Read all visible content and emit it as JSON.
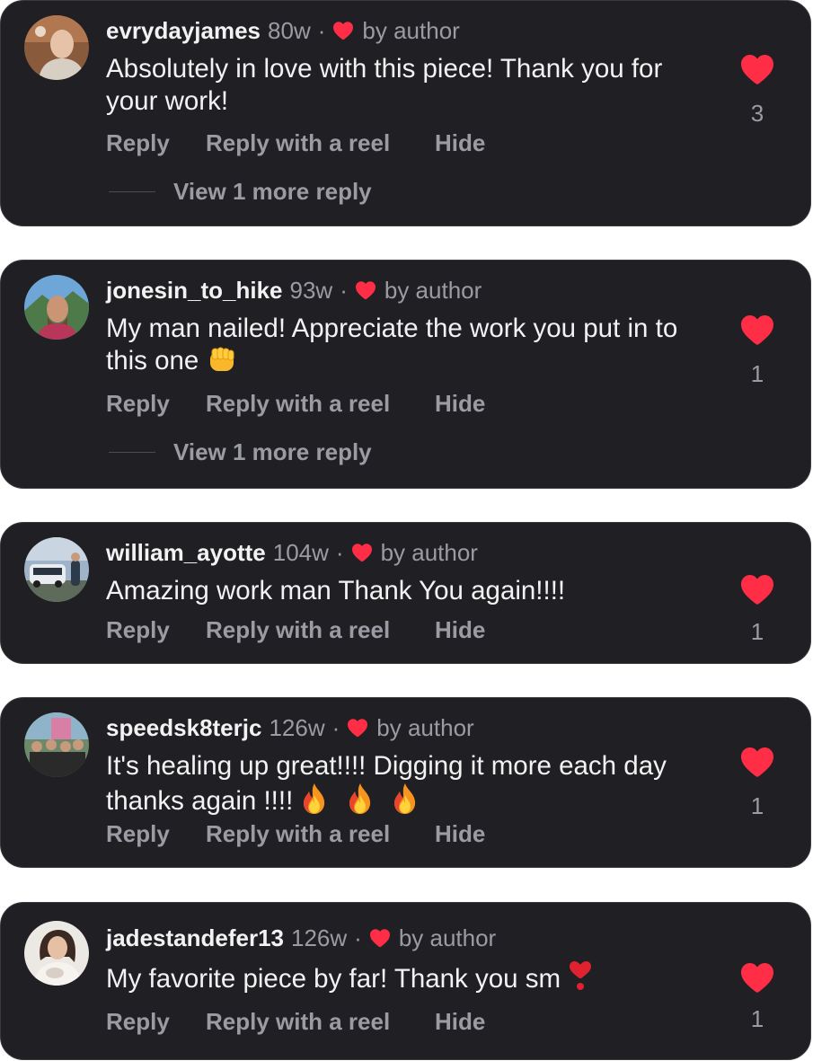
{
  "colors": {
    "card_bg": "#202024",
    "heart_red": "#ff2d46",
    "text_primary": "#f2f2f2",
    "text_secondary": "#9b9ba3"
  },
  "actions": {
    "reply": "Reply",
    "reply_reel": "Reply with a reel",
    "hide": "Hide"
  },
  "comments": [
    {
      "username": "evrydayjames",
      "time": "80w",
      "separator": "·",
      "author_tag": "by author",
      "text": "Absolutely in love with this piece! Thank you for your work!",
      "likes": "3",
      "more_replies": "View 1 more reply",
      "avatar_icon": "profile-photo"
    },
    {
      "username": "jonesin_to_hike",
      "time": "93w",
      "separator": "·",
      "author_tag": "by author",
      "text": "My man nailed! Appreciate the work you put in to this one",
      "text_emoji": "oncoming-fist-emoji",
      "likes": "1",
      "more_replies": "View 1 more reply",
      "avatar_icon": "profile-photo"
    },
    {
      "username": "william_ayotte",
      "time": "104w",
      "separator": "·",
      "author_tag": "by author",
      "text": "Amazing work man Thank You again!!!!",
      "likes": "1",
      "avatar_icon": "profile-photo"
    },
    {
      "username": "speedsk8terjc",
      "time": "126w",
      "separator": "·",
      "author_tag": "by author",
      "text": "It's healing up great!!!! Digging it more each day thanks again !!!!",
      "text_emoji": "fire-emoji x3",
      "likes": "1",
      "avatar_icon": "profile-photo"
    },
    {
      "username": "jadestandefer13",
      "time": "126w",
      "separator": "·",
      "author_tag": "by author",
      "text": "My favorite piece by far! Thank you sm",
      "text_emoji": "heart-exclamation-emoji",
      "likes": "1",
      "avatar_icon": "profile-photo"
    }
  ]
}
